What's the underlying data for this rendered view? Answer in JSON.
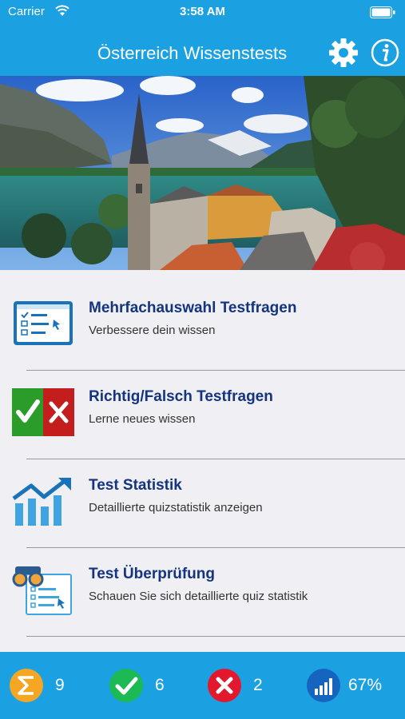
{
  "status_bar": {
    "carrier": "Carrier",
    "time": "3:58 AM",
    "wifi_icon": "wifi-icon",
    "battery_icon": "battery-icon"
  },
  "nav": {
    "title": "Österreich Wissenstests",
    "settings_icon": "gear-icon",
    "info_icon": "info-icon"
  },
  "menu": {
    "items": [
      {
        "title": "Mehrfachauswahl Testfragen",
        "subtitle": "Verbessere dein wissen",
        "icon": "multiple-choice-icon"
      },
      {
        "title": "Richtig/Falsch Testfragen",
        "subtitle": "Lerne neues wissen",
        "icon": "true-false-icon"
      },
      {
        "title": "Test Statistik",
        "subtitle": "Detaillierte quizstatistik anzeigen",
        "icon": "statistics-chart-icon"
      },
      {
        "title": "Test Überprüfung",
        "subtitle": "Schauen Sie sich detaillierte quiz statistik",
        "icon": "review-binoculars-icon"
      }
    ]
  },
  "stats": {
    "total": {
      "value": "9",
      "icon": "sigma-icon",
      "color": "#f5a623"
    },
    "correct": {
      "value": "6",
      "icon": "checkmark-icon",
      "color": "#1db954"
    },
    "wrong": {
      "value": "2",
      "icon": "cross-icon",
      "color": "#e3182d"
    },
    "percent": {
      "value": "67%",
      "icon": "signal-bars-icon",
      "color": "#1565c0"
    }
  },
  "colors": {
    "brand_blue": "#1ba1e2",
    "title_navy": "#14347e"
  }
}
